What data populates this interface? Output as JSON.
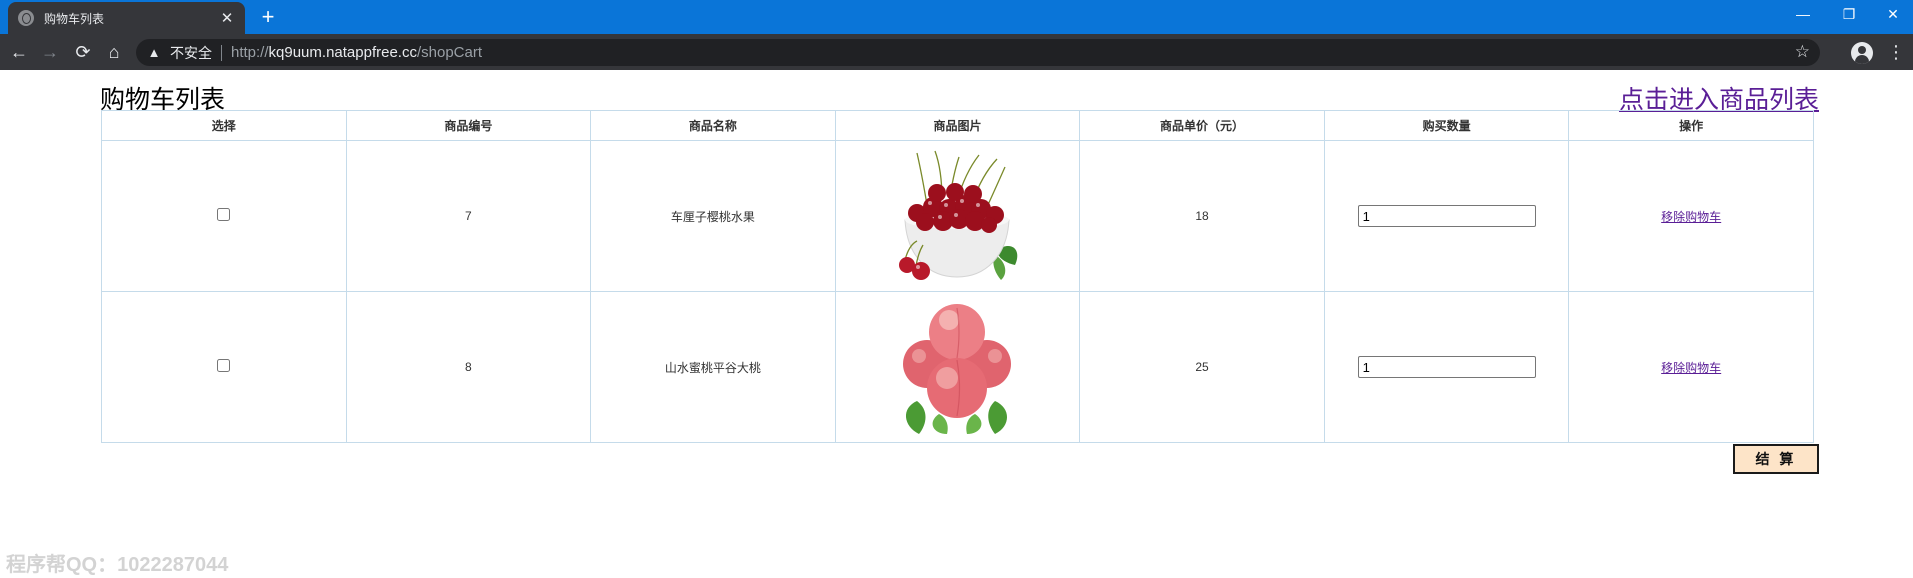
{
  "browser": {
    "tab_title": "购物车列表",
    "tab_close": "✕",
    "new_tab": "+",
    "window": {
      "minimize": "—",
      "maximize": "❐",
      "close": "✕"
    },
    "nav": {
      "back": "←",
      "forward": "→",
      "reload": "⟳",
      "home": "⌂"
    },
    "omnibox": {
      "warning_icon": "▲",
      "security_label": "不安全",
      "url_scheme": "http://",
      "url_host": "kq9uum.natappfree.cc",
      "url_path": "/shopCart",
      "star_icon": "☆"
    },
    "menu_icon": "⋮"
  },
  "page": {
    "title": "购物车列表",
    "goods_link": "点击进入商品列表",
    "table": {
      "headers": [
        "选择",
        "商品编号",
        "商品名称",
        "商品图片",
        "商品单价（元）",
        "购买数量",
        "操作"
      ],
      "rows": [
        {
          "id": "7",
          "name": "车厘子樱桃水果",
          "image": "cherry-bowl",
          "price": "18",
          "quantity": "1",
          "action": "移除购物车",
          "checked": false
        },
        {
          "id": "8",
          "name": "山水蜜桃平谷大桃",
          "image": "peach-pile",
          "price": "25",
          "quantity": "1",
          "action": "移除购物车",
          "checked": false
        }
      ]
    },
    "checkout_label": "结 算",
    "watermark": "程序帮QQ：1022287044"
  },
  "colors": {
    "tabbar": "#0a75d8",
    "toolbar": "#35363a",
    "link": "#5a1e96",
    "table_border": "#c5dbea",
    "checkout_bg": "#fde4c8"
  }
}
